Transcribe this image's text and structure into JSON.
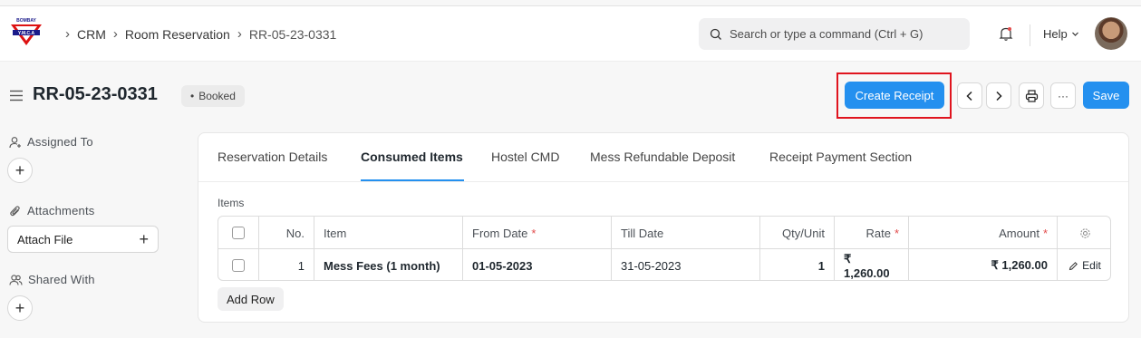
{
  "navbar": {
    "logo_text_top": "BOMBAY",
    "logo_text_bottom": "Y.M.C.A",
    "breadcrumbs": [
      "CRM",
      "Room Reservation",
      "RR-05-23-0331"
    ],
    "search_placeholder": "Search or type a command (Ctrl + G)",
    "help_label": "Help"
  },
  "doc": {
    "title": "RR-05-23-0331",
    "status": "Booked",
    "status_dot": "•",
    "create_receipt_label": "Create Receipt",
    "save_label": "Save",
    "more_label": "···"
  },
  "sidebar": {
    "assigned_to": "Assigned To",
    "attachments": "Attachments",
    "attach_file": "Attach File",
    "shared_with": "Shared With"
  },
  "tabs": [
    {
      "label": "Reservation Details",
      "active": false
    },
    {
      "label": "Consumed Items",
      "active": true
    },
    {
      "label": "Hostel CMD",
      "active": false
    },
    {
      "label": "Mess Refundable Deposit",
      "active": false
    },
    {
      "label": "Receipt Payment Section",
      "active": false
    }
  ],
  "items_table": {
    "label": "Items",
    "columns": [
      "No.",
      "Item",
      "From Date",
      "Till Date",
      "Qty/Unit",
      "Rate",
      "Amount"
    ],
    "required_mark": "*",
    "rows": [
      {
        "no": "1",
        "item": "Mess Fees (1 month)",
        "from_date": "01-05-2023",
        "till_date": "31-05-2023",
        "qty": "1",
        "rate": "₹ 1,260.00",
        "amount": "₹ 1,260.00",
        "edit": "Edit"
      }
    ],
    "add_row": "Add Row"
  },
  "colors": {
    "primary": "#2490ef",
    "highlight": "#e0141e"
  }
}
